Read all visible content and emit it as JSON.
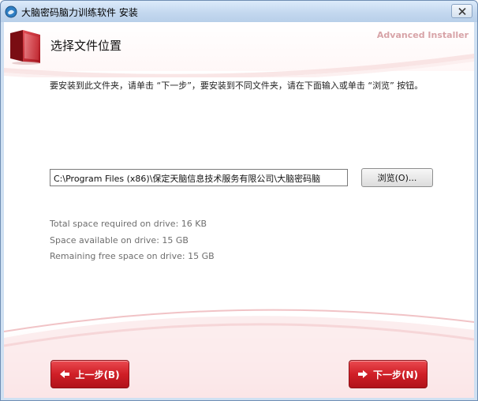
{
  "window": {
    "title": "大脑密码脑力训练软件 安装",
    "close_icon": "close-icon",
    "app_icon": "app-icon"
  },
  "header": {
    "title": "选择文件位置",
    "brand": "Advanced Installer",
    "icon": "folder-icon"
  },
  "instruction": "要安装到此文件夹，请单击 “下一步”，要安装到不同文件夹，请在下面输入或单击 “浏览” 按钮。",
  "path_field": {
    "value": "C:\\Program Files (x86)\\保定天脑信息技术服务有限公司\\大脑密码脑"
  },
  "browse_button": {
    "label": "浏览(O)..."
  },
  "space": {
    "required": "Total space required on drive: 16 KB",
    "available": "Space available on drive: 15 GB",
    "remaining": "Remaining free space on drive: 15 GB"
  },
  "buttons": {
    "back": {
      "label": "上一步(B)",
      "icon": "arrow-left-icon"
    },
    "next": {
      "label": "下一步(N)",
      "icon": "arrow-right-icon"
    }
  },
  "colors": {
    "accent_red": "#d01f27",
    "brand_text": "#d7a3a7",
    "titlebar": "#c4d8ef"
  }
}
